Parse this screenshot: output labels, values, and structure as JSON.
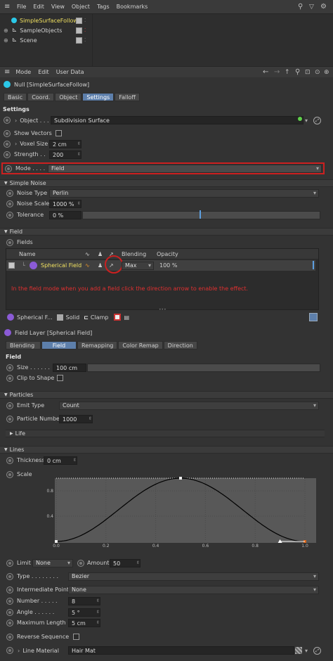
{
  "menu": {
    "items": [
      "File",
      "Edit",
      "View",
      "Object",
      "Tags",
      "Bookmarks"
    ]
  },
  "objects": [
    {
      "name": "SimpleSurfaceFollow",
      "selected": true
    },
    {
      "name": "SampleObjects",
      "selected": false
    },
    {
      "name": "Scene",
      "selected": false
    }
  ],
  "attr_menu": {
    "items": [
      "Mode",
      "Edit",
      "User Data"
    ]
  },
  "object_title": "Null [SimpleSurfaceFollow]",
  "tabs": [
    "Basic",
    "Coord.",
    "Object",
    "Settings",
    "Falloff"
  ],
  "active_tab": "Settings",
  "settings": {
    "heading": "Settings",
    "object_label": "Object . . .",
    "object_value": "Subdivision Surface",
    "show_vectors_label": "Show Vectors",
    "voxel_size_label": "Voxel Size",
    "voxel_size_value": "2 cm",
    "strength_label": "Strength . .",
    "strength_value": "200",
    "mode_label": "Mode . . . .",
    "mode_value": "Field"
  },
  "simple_noise": {
    "heading": "Simple Noise",
    "noise_type_label": "Noise Type",
    "noise_type_value": "Perlin",
    "noise_scale_label": "Noise Scale",
    "noise_scale_value": "1000 %",
    "tolerance_label": "Tolerance",
    "tolerance_value": "0 %"
  },
  "field": {
    "heading": "Field",
    "fields_label": "Fields",
    "col_name": "Name",
    "col_blending": "Blending",
    "col_opacity": "Opacity",
    "row_name": "Spherical Field",
    "row_blending": "Max",
    "row_opacity": "100 %",
    "annotation": "In the field mode when you add a field click the direction arrow to enable the effect.",
    "toolbar": [
      "Spherical F...",
      "Solid",
      "Clamp"
    ]
  },
  "field_layer": {
    "title": "Field Layer [Spherical Field]",
    "tabs": [
      "Blending",
      "Field",
      "Remapping",
      "Color Remap",
      "Direction"
    ],
    "active_tab": "Field",
    "heading": "Field",
    "size_label": "Size . . . . . .",
    "size_value": "100 cm",
    "clip_label": "Clip to Shape"
  },
  "particles": {
    "heading": "Particles",
    "emit_type_label": "Emit Type",
    "emit_type_value": "Count",
    "particle_number_label": "Particle Number",
    "particle_number_value": "1000",
    "life_label": "Life"
  },
  "lines": {
    "heading": "Lines",
    "thickness_label": "Thickness",
    "thickness_value": "0 cm",
    "scale_label": "Scale",
    "limit_label": "Limit",
    "limit_value": "None",
    "amount_label": "Amount",
    "amount_value": "50",
    "type_label": "Type . . . . . . . .",
    "type_value": "Bezier",
    "intermediate_label": "Intermediate Points",
    "intermediate_value": "None",
    "number_label": "Number . . . . .",
    "number_value": "8",
    "angle_label": "Angle . . . . . .",
    "angle_value": "5 °",
    "max_length_label": "Maximum Length",
    "max_length_value": "5 cm",
    "reverse_label": "Reverse Sequence",
    "line_material_label": "Line Material",
    "line_material_value": "Hair Mat"
  },
  "chart_data": {
    "type": "line",
    "x_ticks": [
      "0.0",
      "0.2",
      "0.4",
      "0.6",
      "0.8",
      "1.0"
    ],
    "y_ticks": [
      "0.8",
      "0.4"
    ],
    "x": [
      0,
      0.1,
      0.2,
      0.3,
      0.4,
      0.5,
      0.6,
      0.7,
      0.8,
      0.9,
      1.0
    ],
    "y": [
      0,
      0.1,
      0.35,
      0.65,
      0.9,
      1.0,
      0.9,
      0.65,
      0.35,
      0.1,
      0
    ],
    "xlim": [
      0,
      1
    ],
    "ylim": [
      0,
      1
    ],
    "curve_color": "#000000",
    "accent": "#d7661c"
  },
  "colors": {
    "highlight": "#cc2020",
    "accent_blue": "#5d7fab",
    "cyan": "#2bc8e8"
  }
}
